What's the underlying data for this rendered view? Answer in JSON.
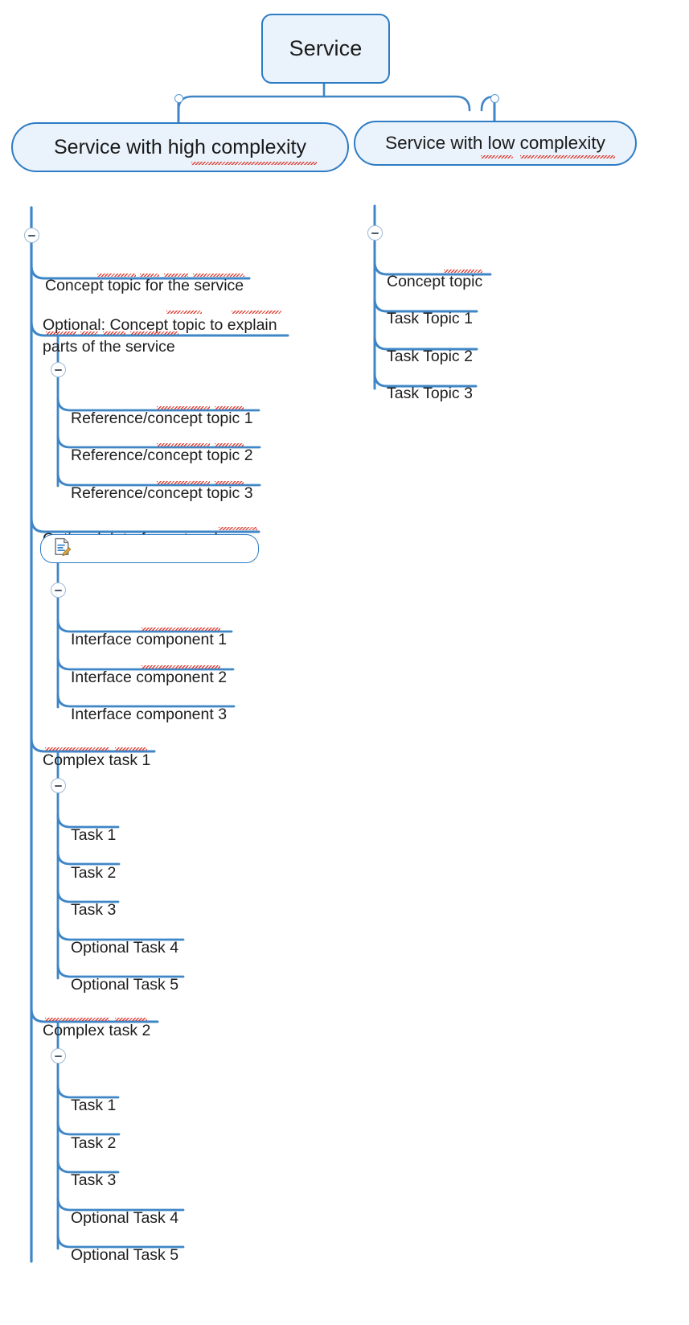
{
  "diagram": {
    "title": "Service",
    "accent_color": "#2e7cc4",
    "node_fill": "#eaf2fb",
    "background": "#ffffff",
    "icons": {
      "note": "document-edit-icon",
      "collapse": "minus-circle-icon",
      "junction": "circle-marker-icon"
    }
  },
  "root": {
    "label": "Service"
  },
  "branches": [
    {
      "id": "high",
      "label": "Service with high complexity",
      "has_note": true,
      "collapse_state": "expanded",
      "children": [
        {
          "label": "Concept topic for the service"
        },
        {
          "label": "Optional: Concept topic to explain\nparts of the service",
          "collapse_state": "expanded",
          "children": [
            {
              "label": "Reference/concept topic 1"
            },
            {
              "label": "Reference/concept topic 2"
            },
            {
              "label": "Reference/concept topic 3"
            }
          ]
        },
        {
          "label": "Optional: Interface at a glance",
          "has_note": true,
          "collapse_state": "expanded",
          "children": [
            {
              "label": "Interface component 1"
            },
            {
              "label": "Interface component 2"
            },
            {
              "label": "Interface component 3"
            }
          ]
        },
        {
          "label": "Complex task 1",
          "collapse_state": "expanded",
          "children": [
            {
              "label": "Task 1"
            },
            {
              "label": "Task 2"
            },
            {
              "label": "Task 3"
            },
            {
              "label": "Optional Task 4"
            },
            {
              "label": "Optional Task 5"
            }
          ]
        },
        {
          "label": "Complex task 2",
          "collapse_state": "expanded",
          "children": [
            {
              "label": "Task 1"
            },
            {
              "label": "Task 2"
            },
            {
              "label": "Task 3"
            },
            {
              "label": "Optional Task 4"
            },
            {
              "label": "Optional Task 5"
            }
          ]
        }
      ]
    },
    {
      "id": "low",
      "label": "Service with low complexity",
      "has_note": true,
      "collapse_state": "expanded",
      "children": [
        {
          "label": "Concept topic"
        },
        {
          "label": "Task Topic 1"
        },
        {
          "label": "Task Topic 2"
        },
        {
          "label": "Task Topic 3"
        }
      ]
    }
  ]
}
